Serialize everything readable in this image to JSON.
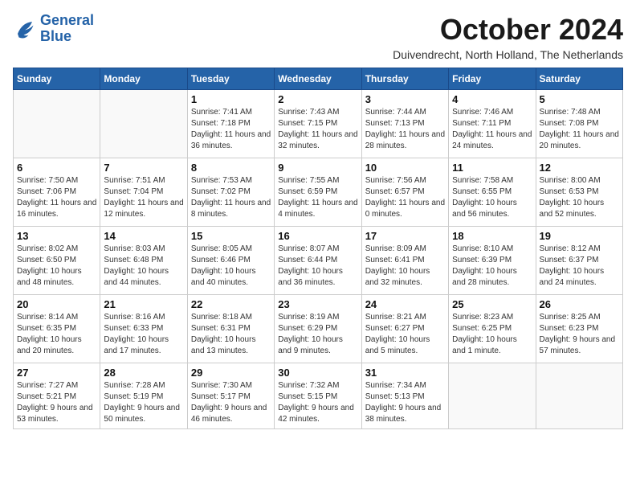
{
  "logo": {
    "line1": "General",
    "line2": "Blue"
  },
  "title": "October 2024",
  "location": "Duivendrecht, North Holland, The Netherlands",
  "weekdays": [
    "Sunday",
    "Monday",
    "Tuesday",
    "Wednesday",
    "Thursday",
    "Friday",
    "Saturday"
  ],
  "weeks": [
    [
      {
        "day": null
      },
      {
        "day": null
      },
      {
        "day": "1",
        "sunrise": "7:41 AM",
        "sunset": "7:18 PM",
        "daylight": "11 hours and 36 minutes."
      },
      {
        "day": "2",
        "sunrise": "7:43 AM",
        "sunset": "7:15 PM",
        "daylight": "11 hours and 32 minutes."
      },
      {
        "day": "3",
        "sunrise": "7:44 AM",
        "sunset": "7:13 PM",
        "daylight": "11 hours and 28 minutes."
      },
      {
        "day": "4",
        "sunrise": "7:46 AM",
        "sunset": "7:11 PM",
        "daylight": "11 hours and 24 minutes."
      },
      {
        "day": "5",
        "sunrise": "7:48 AM",
        "sunset": "7:08 PM",
        "daylight": "11 hours and 20 minutes."
      }
    ],
    [
      {
        "day": "6",
        "sunrise": "7:50 AM",
        "sunset": "7:06 PM",
        "daylight": "11 hours and 16 minutes."
      },
      {
        "day": "7",
        "sunrise": "7:51 AM",
        "sunset": "7:04 PM",
        "daylight": "11 hours and 12 minutes."
      },
      {
        "day": "8",
        "sunrise": "7:53 AM",
        "sunset": "7:02 PM",
        "daylight": "11 hours and 8 minutes."
      },
      {
        "day": "9",
        "sunrise": "7:55 AM",
        "sunset": "6:59 PM",
        "daylight": "11 hours and 4 minutes."
      },
      {
        "day": "10",
        "sunrise": "7:56 AM",
        "sunset": "6:57 PM",
        "daylight": "11 hours and 0 minutes."
      },
      {
        "day": "11",
        "sunrise": "7:58 AM",
        "sunset": "6:55 PM",
        "daylight": "10 hours and 56 minutes."
      },
      {
        "day": "12",
        "sunrise": "8:00 AM",
        "sunset": "6:53 PM",
        "daylight": "10 hours and 52 minutes."
      }
    ],
    [
      {
        "day": "13",
        "sunrise": "8:02 AM",
        "sunset": "6:50 PM",
        "daylight": "10 hours and 48 minutes."
      },
      {
        "day": "14",
        "sunrise": "8:03 AM",
        "sunset": "6:48 PM",
        "daylight": "10 hours and 44 minutes."
      },
      {
        "day": "15",
        "sunrise": "8:05 AM",
        "sunset": "6:46 PM",
        "daylight": "10 hours and 40 minutes."
      },
      {
        "day": "16",
        "sunrise": "8:07 AM",
        "sunset": "6:44 PM",
        "daylight": "10 hours and 36 minutes."
      },
      {
        "day": "17",
        "sunrise": "8:09 AM",
        "sunset": "6:41 PM",
        "daylight": "10 hours and 32 minutes."
      },
      {
        "day": "18",
        "sunrise": "8:10 AM",
        "sunset": "6:39 PM",
        "daylight": "10 hours and 28 minutes."
      },
      {
        "day": "19",
        "sunrise": "8:12 AM",
        "sunset": "6:37 PM",
        "daylight": "10 hours and 24 minutes."
      }
    ],
    [
      {
        "day": "20",
        "sunrise": "8:14 AM",
        "sunset": "6:35 PM",
        "daylight": "10 hours and 20 minutes."
      },
      {
        "day": "21",
        "sunrise": "8:16 AM",
        "sunset": "6:33 PM",
        "daylight": "10 hours and 17 minutes."
      },
      {
        "day": "22",
        "sunrise": "8:18 AM",
        "sunset": "6:31 PM",
        "daylight": "10 hours and 13 minutes."
      },
      {
        "day": "23",
        "sunrise": "8:19 AM",
        "sunset": "6:29 PM",
        "daylight": "10 hours and 9 minutes."
      },
      {
        "day": "24",
        "sunrise": "8:21 AM",
        "sunset": "6:27 PM",
        "daylight": "10 hours and 5 minutes."
      },
      {
        "day": "25",
        "sunrise": "8:23 AM",
        "sunset": "6:25 PM",
        "daylight": "10 hours and 1 minute."
      },
      {
        "day": "26",
        "sunrise": "8:25 AM",
        "sunset": "6:23 PM",
        "daylight": "9 hours and 57 minutes."
      }
    ],
    [
      {
        "day": "27",
        "sunrise": "7:27 AM",
        "sunset": "5:21 PM",
        "daylight": "9 hours and 53 minutes."
      },
      {
        "day": "28",
        "sunrise": "7:28 AM",
        "sunset": "5:19 PM",
        "daylight": "9 hours and 50 minutes."
      },
      {
        "day": "29",
        "sunrise": "7:30 AM",
        "sunset": "5:17 PM",
        "daylight": "9 hours and 46 minutes."
      },
      {
        "day": "30",
        "sunrise": "7:32 AM",
        "sunset": "5:15 PM",
        "daylight": "9 hours and 42 minutes."
      },
      {
        "day": "31",
        "sunrise": "7:34 AM",
        "sunset": "5:13 PM",
        "daylight": "9 hours and 38 minutes."
      },
      {
        "day": null
      },
      {
        "day": null
      }
    ]
  ]
}
